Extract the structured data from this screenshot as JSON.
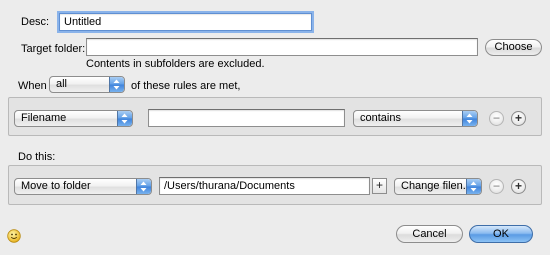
{
  "desc": {
    "label": "Desc:",
    "value": "Untitled"
  },
  "target_folder": {
    "label": "Target folder:",
    "value": "",
    "choose_label": "Choose",
    "note": "Contents in subfolders are excluded."
  },
  "when": {
    "label": "When",
    "match_value": "all",
    "suffix": "of these rules are met,"
  },
  "rule": {
    "attribute_value": "Filename",
    "text_value": "",
    "operator_value": "contains",
    "remove_label": "−",
    "add_label": "+"
  },
  "do_this": {
    "label": "Do this:",
    "action_value": "Move to folder",
    "path_value": "/Users/thurana/Documents",
    "path_add_label": "+",
    "option_value": "Change filen...",
    "remove_label": "−",
    "add_label": "+"
  },
  "footer": {
    "status_icon": "smiley-icon",
    "cancel_label": "Cancel",
    "ok_label": "OK"
  }
}
